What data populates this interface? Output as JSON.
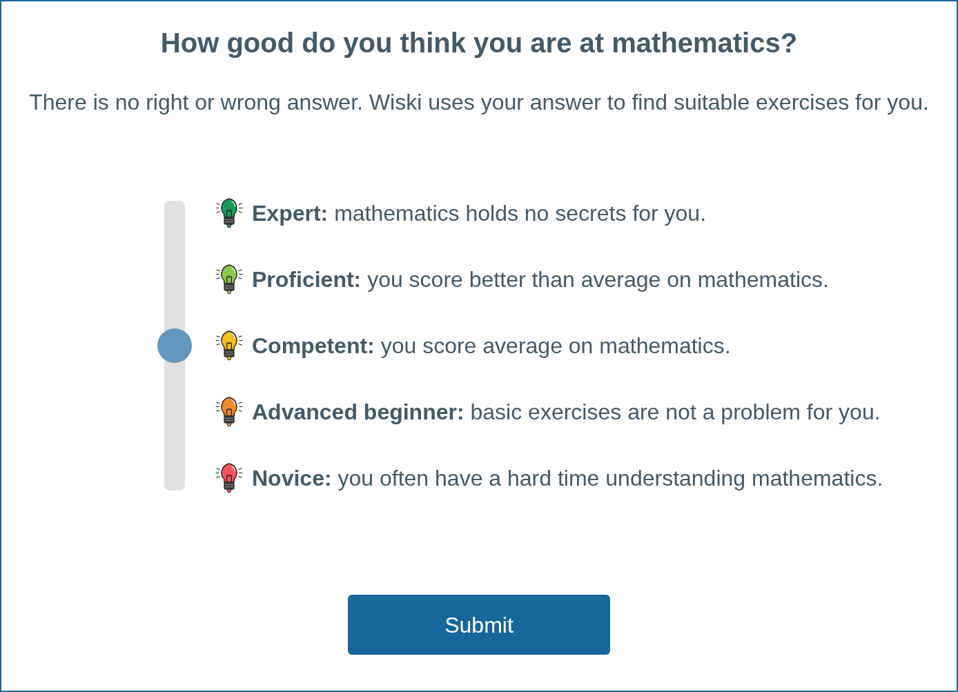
{
  "title": "How good do you think you are at mathematics?",
  "subtitle": "There is no right or wrong answer. Wiski uses your answer to find suitable exercises for you.",
  "slider": {
    "level": 0.5
  },
  "options": [
    {
      "text": "**Expert:** mathematics holds no secrets for you.",
      "color": "#1a9b55"
    },
    {
      "text": "**Proficient:** you score better than average on mathematics.",
      "color": "#8cc84b"
    },
    {
      "text": "**Competent:** you score average on mathematics.",
      "color": "#f4bf1f"
    },
    {
      "text": "**Advanced beginner:** basic exercises are not a problem for you.",
      "color": "#f28a2e"
    },
    {
      "text": "**Novice:** you often have a hard time understanding mathematics.",
      "color": "#f6535d"
    }
  ],
  "submit_button": "Submit"
}
